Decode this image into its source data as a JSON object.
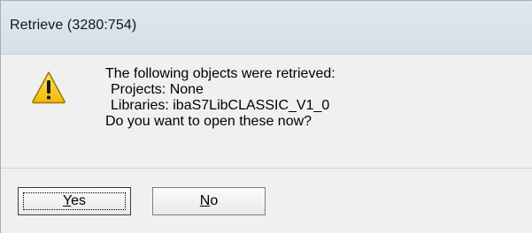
{
  "window": {
    "title": "Retrieve (3280:754)"
  },
  "message": {
    "icon": "warning-icon",
    "lines": [
      "The following objects were retrieved:",
      "Projects: None",
      "Libraries: ibaS7LibCLASSIC_V1_0",
      "Do you want to open these now?"
    ]
  },
  "buttons": {
    "yes": {
      "accel": "Y",
      "rest": "es"
    },
    "no": {
      "accel": "N",
      "rest": "o"
    }
  },
  "colors": {
    "warning_fill": "#f5c518",
    "warning_outline": "#8a6d00"
  }
}
